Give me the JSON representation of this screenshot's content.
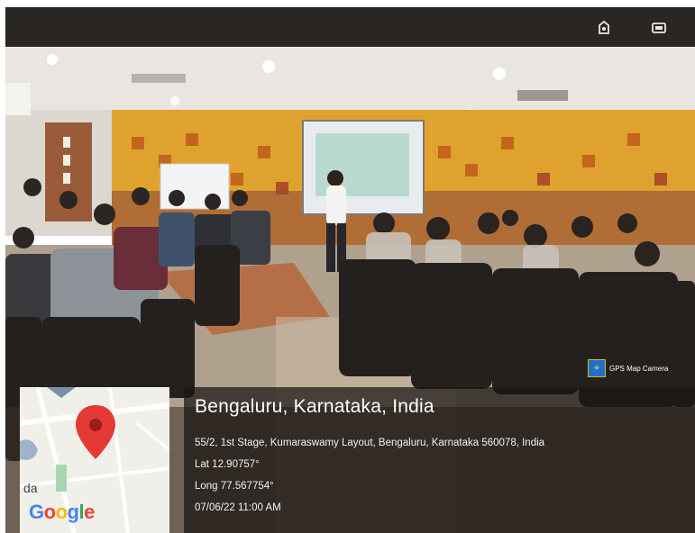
{
  "top_bar": {
    "icons": [
      "share-icon",
      "cast-icon"
    ]
  },
  "camera_badge": {
    "label": "GPS Map Camera",
    "icon": "gps-map-camera-logo"
  },
  "map": {
    "logo_text": "Google",
    "fragment_text": "da",
    "pin_color": "#e53935"
  },
  "location": {
    "place": "Bengaluru, Karnataka, India",
    "address": "55/2, 1st Stage, Kumaraswamy Layout, Bengaluru, Karnataka 560078, India",
    "latitude": "Lat 12.90757°",
    "longitude": "Long 77.567754°",
    "timestamp": "07/06/22 11:00 AM"
  }
}
